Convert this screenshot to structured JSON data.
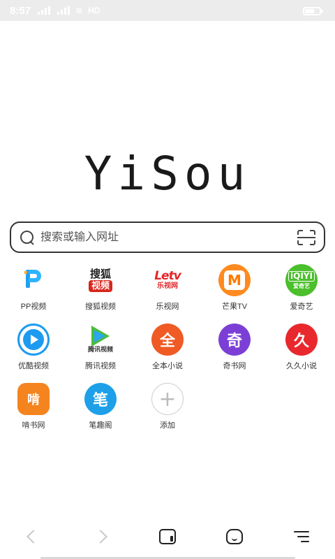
{
  "status_bar": {
    "time": "8:57",
    "network_label": "HD",
    "battery_level": 0.6
  },
  "logo": "YiSou",
  "search": {
    "placeholder": "搜索或输入网址"
  },
  "shortcuts": [
    {
      "label": "PP视频",
      "icon": "pp-video-icon"
    },
    {
      "label": "搜狐视频",
      "icon": "sohu-video-icon",
      "icon_text_top": "搜狐",
      "icon_text_bottom": "视频"
    },
    {
      "label": "乐视网",
      "icon": "letv-icon",
      "icon_text_top": "Letv",
      "icon_text_bottom": "乐视网"
    },
    {
      "label": "芒果TV",
      "icon": "mango-tv-icon",
      "icon_text": "M"
    },
    {
      "label": "爱奇艺",
      "icon": "iqiyi-icon",
      "icon_text_top": "iQIYI",
      "icon_text_bottom": "爱奇艺"
    },
    {
      "label": "优酷视频",
      "icon": "youku-icon"
    },
    {
      "label": "腾讯视频",
      "icon": "tencent-video-icon",
      "icon_text_bottom": "腾讯视频"
    },
    {
      "label": "全本小说",
      "icon": "quanben-novel-icon",
      "icon_text": "全"
    },
    {
      "label": "奇书网",
      "icon": "qishu-icon",
      "icon_text": "奇"
    },
    {
      "label": "久久小说",
      "icon": "jiujiu-novel-icon",
      "icon_text": "久"
    },
    {
      "label": "啃书网",
      "icon": "kenshu-icon",
      "icon_text": "啃"
    },
    {
      "label": "笔趣阁",
      "icon": "biquge-icon",
      "icon_text": "笔"
    },
    {
      "label": "添加",
      "icon": "add-icon",
      "icon_text": "+"
    }
  ],
  "bottom_nav": {
    "back": "chevron-left-icon",
    "forward": "chevron-right-icon",
    "tabs": "tabs-icon",
    "home": "home-icon",
    "menu": "menu-icon"
  },
  "colors": {
    "status_bar_bg": "#ececec",
    "youku": "#1d9bf0",
    "mango": "#ff8a1f",
    "iqiyi": "#4bbf2c",
    "quanben": "#f05a24",
    "qishu": "#7b3fd6",
    "jiujiu": "#e8282c",
    "kenshu": "#f5841f",
    "biquge": "#1ea0e8"
  }
}
